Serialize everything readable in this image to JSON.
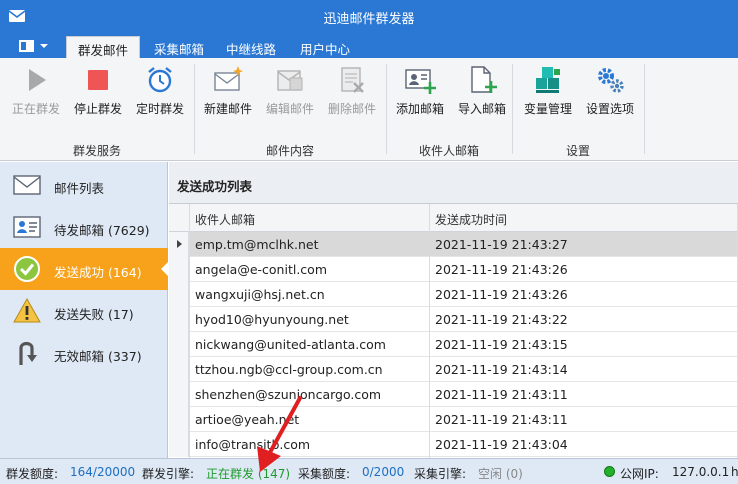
{
  "window": {
    "title": "迅迪邮件群发器"
  },
  "tabs": [
    {
      "label": "群发邮件",
      "active": true
    },
    {
      "label": "采集邮箱",
      "active": false
    },
    {
      "label": "中继线路",
      "active": false
    },
    {
      "label": "用户中心",
      "active": false
    }
  ],
  "ribbon": {
    "groups": [
      {
        "label": "群发服务"
      },
      {
        "label": "邮件内容"
      },
      {
        "label": "收件人邮箱"
      },
      {
        "label": "设置"
      }
    ],
    "buttons": [
      {
        "label": "正在群发",
        "icon": "play-icon",
        "disabled": true
      },
      {
        "label": "停止群发",
        "icon": "stop-icon",
        "disabled": false
      },
      {
        "label": "定时群发",
        "icon": "alarm-clock-icon",
        "disabled": false
      },
      {
        "label": "新建邮件",
        "icon": "new-mail-icon",
        "disabled": false
      },
      {
        "label": "编辑邮件",
        "icon": "edit-mail-icon",
        "disabled": true
      },
      {
        "label": "删除邮件",
        "icon": "delete-mail-icon",
        "disabled": true
      },
      {
        "label": "添加邮箱",
        "icon": "add-contact-icon",
        "disabled": false
      },
      {
        "label": "导入邮箱",
        "icon": "import-file-icon",
        "disabled": false
      },
      {
        "label": "变量管理",
        "icon": "cubes-icon",
        "disabled": false
      },
      {
        "label": "设置选项",
        "icon": "gears-icon",
        "disabled": false
      }
    ]
  },
  "sidebar": {
    "items": [
      {
        "label": "邮件列表",
        "icon": "envelope-icon",
        "active": false
      },
      {
        "label": "待发邮箱 (7629)",
        "icon": "contact-card-icon",
        "active": false
      },
      {
        "label": "发送成功 (164)",
        "icon": "check-circle-icon",
        "active": true
      },
      {
        "label": "发送失败 (17)",
        "icon": "warning-icon",
        "active": false
      },
      {
        "label": "无效邮箱 (337)",
        "icon": "return-arrow-icon",
        "active": false
      }
    ]
  },
  "panel": {
    "title": "发送成功列表",
    "columns": [
      "收件人邮箱",
      "发送成功时间"
    ],
    "rows": [
      {
        "email": "emp.tm@mclhk.net",
        "time": "2021-11-19 21:43:27"
      },
      {
        "email": "angela@e-conitl.com",
        "time": "2021-11-19 21:43:26"
      },
      {
        "email": "wangxuji@hsj.net.cn",
        "time": "2021-11-19 21:43:26"
      },
      {
        "email": "hyod10@hyunyoung.net",
        "time": "2021-11-19 21:43:22"
      },
      {
        "email": "nickwang@united-atlanta.com",
        "time": "2021-11-19 21:43:15"
      },
      {
        "email": "ttzhou.ngb@ccl-group.com.cn",
        "time": "2021-11-19 21:43:14"
      },
      {
        "email": "shenzhen@szunioncargo.com",
        "time": "2021-11-19 21:43:11"
      },
      {
        "email": "artioe@yeah.net",
        "time": "2021-11-19 21:43:11"
      },
      {
        "email": "info@transitb.com",
        "time": "2021-11-19 21:43:04"
      }
    ]
  },
  "status": {
    "quota_label": "群发额度:",
    "quota_value": "164/20000",
    "engine_label": "群发引擎:",
    "engine_value": "正在群发 (147)",
    "collect_quota_label": "采集额度:",
    "collect_quota_value": "0/2000",
    "collect_engine_label": "采集引擎:",
    "collect_engine_value": "空闲 (0)",
    "ip_label": "公网IP:",
    "ip_value": "127.0.0.1",
    "trailing": "h"
  },
  "colors": {
    "titlebar": "#2b78d4",
    "active_item": "#f7a21a",
    "status_blue": "#1b6ec2",
    "status_green": "#1f9b2c",
    "annotation_arrow": "#e02020"
  }
}
